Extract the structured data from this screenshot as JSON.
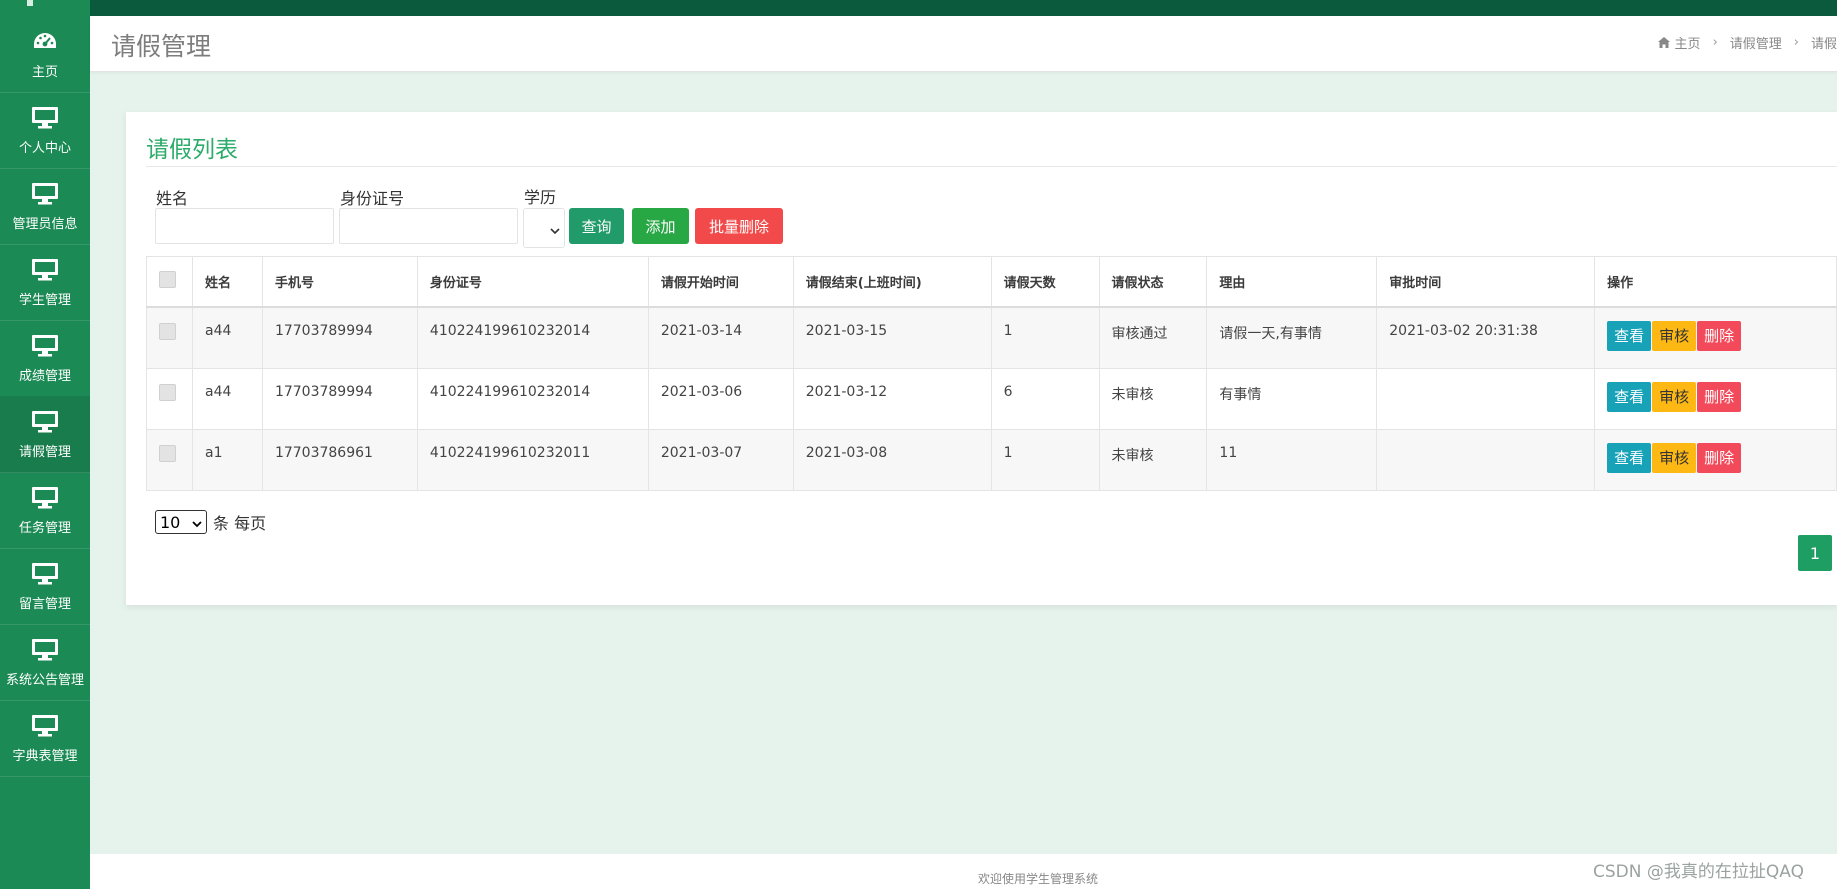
{
  "sidebar": {
    "items": [
      {
        "label": "主页",
        "icon": "dashboard-icon"
      },
      {
        "label": "个人中心",
        "icon": "monitor-icon"
      },
      {
        "label": "管理员信息",
        "icon": "monitor-icon"
      },
      {
        "label": "学生管理",
        "icon": "monitor-icon"
      },
      {
        "label": "成绩管理",
        "icon": "monitor-icon"
      },
      {
        "label": "请假管理",
        "icon": "monitor-icon"
      },
      {
        "label": "任务管理",
        "icon": "monitor-icon"
      },
      {
        "label": "留言管理",
        "icon": "monitor-icon"
      },
      {
        "label": "系统公告管理",
        "icon": "monitor-icon"
      },
      {
        "label": "字典表管理",
        "icon": "monitor-icon"
      }
    ]
  },
  "header": {
    "title": "请假管理",
    "breadcrumb": [
      "主页",
      "请假管理",
      "请假"
    ]
  },
  "card": {
    "title": "请假列表"
  },
  "filters": {
    "name_label": "姓名",
    "name_value": "",
    "id_label": "身份证号",
    "id_value": "",
    "edu_label": "学历",
    "edu_value": ""
  },
  "buttons": {
    "query": "查询",
    "add": "添加",
    "batch_delete": "批量删除"
  },
  "table": {
    "headers": [
      "姓名",
      "手机号",
      "身份证号",
      "请假开始时间",
      "请假结束(上班时间)",
      "请假天数",
      "请假状态",
      "理由",
      "审批时间",
      "操作"
    ],
    "rows": [
      {
        "name": "a44",
        "phone": "17703789994",
        "id_card": "410224199610232014",
        "start": "2021-03-14",
        "end": "2021-03-15",
        "days": "1",
        "status": "审核通过",
        "reason": "请假一天,有事情",
        "approved_at": "2021-03-02 20:31:38"
      },
      {
        "name": "a44",
        "phone": "17703789994",
        "id_card": "410224199610232014",
        "start": "2021-03-06",
        "end": "2021-03-12",
        "days": "6",
        "status": "未审核",
        "reason": "有事情",
        "approved_at": ""
      },
      {
        "name": "a1",
        "phone": "17703786961",
        "id_card": "410224199610232011",
        "start": "2021-03-07",
        "end": "2021-03-08",
        "days": "1",
        "status": "未审核",
        "reason": "11",
        "approved_at": ""
      }
    ],
    "row_actions": {
      "view": "查看",
      "audit": "审核",
      "delete": "删除"
    }
  },
  "pagination": {
    "page_size": "10",
    "page_size_suffix": "条 每页",
    "current_page": "1"
  },
  "footer": {
    "text": "欢迎使用学生管理系统"
  },
  "watermark": "CSDN @我真的在拉扯QAQ",
  "colors": {
    "sidebar": "#1b8a55",
    "topbar": "#0b5a3d",
    "accent_green": "#2cab6a",
    "view": "#17a2b8",
    "audit": "#fdb813",
    "delete": "#f24a5a"
  }
}
